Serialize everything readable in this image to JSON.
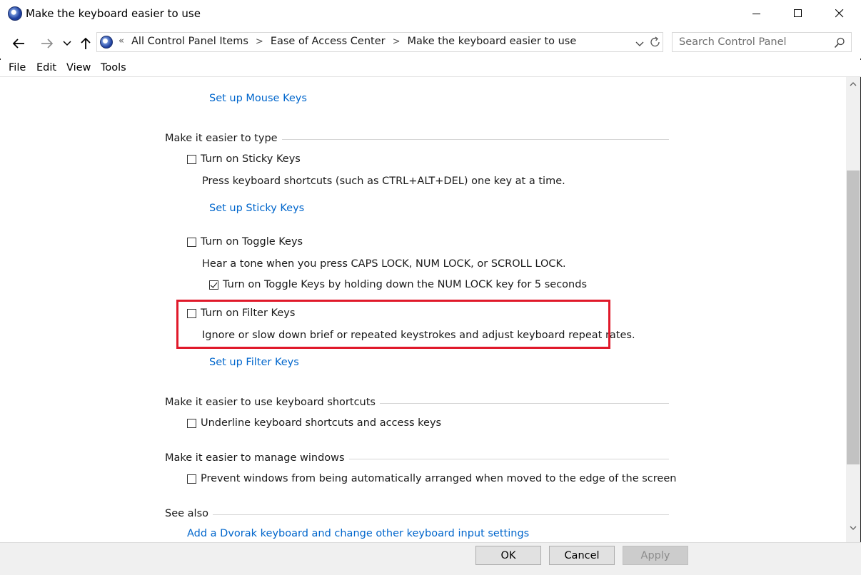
{
  "window": {
    "title": "Make the keyboard easier to use",
    "icon": "ease-of-access-icon"
  },
  "navigation": {
    "back_icon": "back-arrow-icon",
    "forward_icon": "forward-arrow-icon",
    "recent_icon": "chevron-down-icon",
    "up_icon": "up-arrow-icon",
    "overflow": "«",
    "breadcrumbs": [
      "All Control Panel Items",
      "Ease of Access Center",
      "Make the keyboard easier to use"
    ],
    "search_placeholder": "Search Control Panel"
  },
  "menu": [
    "File",
    "Edit",
    "View",
    "Tools"
  ],
  "content": {
    "mouse_keys_link": "Set up Mouse Keys",
    "type_section": {
      "heading": "Make it easier to type",
      "sticky": {
        "label": "Turn on Sticky Keys",
        "checked": false,
        "description": "Press keyboard shortcuts (such as CTRL+ALT+DEL) one key at a time.",
        "link": "Set up Sticky Keys"
      },
      "toggle": {
        "label": "Turn on Toggle Keys",
        "checked": false,
        "description": "Hear a tone when you press CAPS LOCK, NUM LOCK, or SCROLL LOCK.",
        "sub_option": "Turn on Toggle Keys by holding down the NUM LOCK key for 5 seconds",
        "sub_checked": true
      },
      "filter": {
        "label": "Turn on Filter Keys",
        "checked": false,
        "description": "Ignore or slow down brief or repeated keystrokes and adjust keyboard repeat rates.",
        "link": "Set up Filter Keys"
      }
    },
    "shortcuts_section": {
      "heading": "Make it easier to use keyboard shortcuts",
      "underline_label": "Underline keyboard shortcuts and access keys",
      "underline_checked": false
    },
    "windows_section": {
      "heading": "Make it easier to manage windows",
      "prevent_label": "Prevent windows from being automatically arranged when moved to the edge of the screen",
      "prevent_checked": false
    },
    "see_also": {
      "heading": "See also",
      "dvorak_link": "Add a Dvorak keyboard and change other keyboard input settings"
    }
  },
  "buttons": {
    "ok": "OK",
    "cancel": "Cancel",
    "apply": "Apply"
  },
  "colors": {
    "link": "#0066cc",
    "highlight": "#e0192a"
  }
}
